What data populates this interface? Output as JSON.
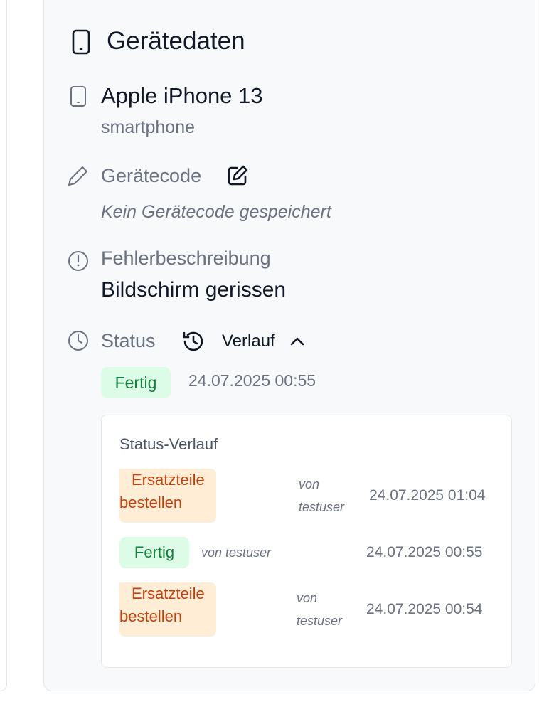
{
  "card": {
    "title": "Gerätedaten",
    "title_icon": "smartphone-icon"
  },
  "device": {
    "icon": "smartphone-icon",
    "name": "Apple iPhone 13",
    "type": "smartphone"
  },
  "device_code": {
    "icon": "pencil-icon",
    "label": "Gerätecode",
    "edit_icon": "edit-icon",
    "empty_text": "Kein Gerätecode gespeichert"
  },
  "error": {
    "icon": "alert-circle-icon",
    "label": "Fehlerbeschreibung",
    "text": "Bildschirm gerissen"
  },
  "status": {
    "icon": "clock-icon",
    "label": "Status",
    "history_button_icon": "history-icon",
    "history_button_label": "Verlauf",
    "history_toggle_icon": "chevron-up-icon",
    "current_badge": "Fertig",
    "current_date": "24.07.2025 00:55"
  },
  "history": {
    "title": "Status-Verlauf",
    "entries": [
      {
        "status_line1": "Ersatzteile",
        "status_line2": "bestellen",
        "by_line1": "von",
        "by_line2": "testuser",
        "date": "24.07.2025 01:04"
      },
      {
        "status": "Fertig",
        "by": "von testuser",
        "date": "24.07.2025 00:55"
      },
      {
        "status_line1": "Ersatzteile",
        "status_line2": "bestellen",
        "by_line1": "von",
        "by_line2": "testuser",
        "date": "24.07.2025 00:54"
      }
    ]
  },
  "colors": {
    "card_background": "#f8f9fb",
    "badge_green_bg": "#dcfce7",
    "badge_green_text": "#15803d",
    "badge_orange_bg": "#ffedd5",
    "badge_orange_text": "#c2410c"
  }
}
